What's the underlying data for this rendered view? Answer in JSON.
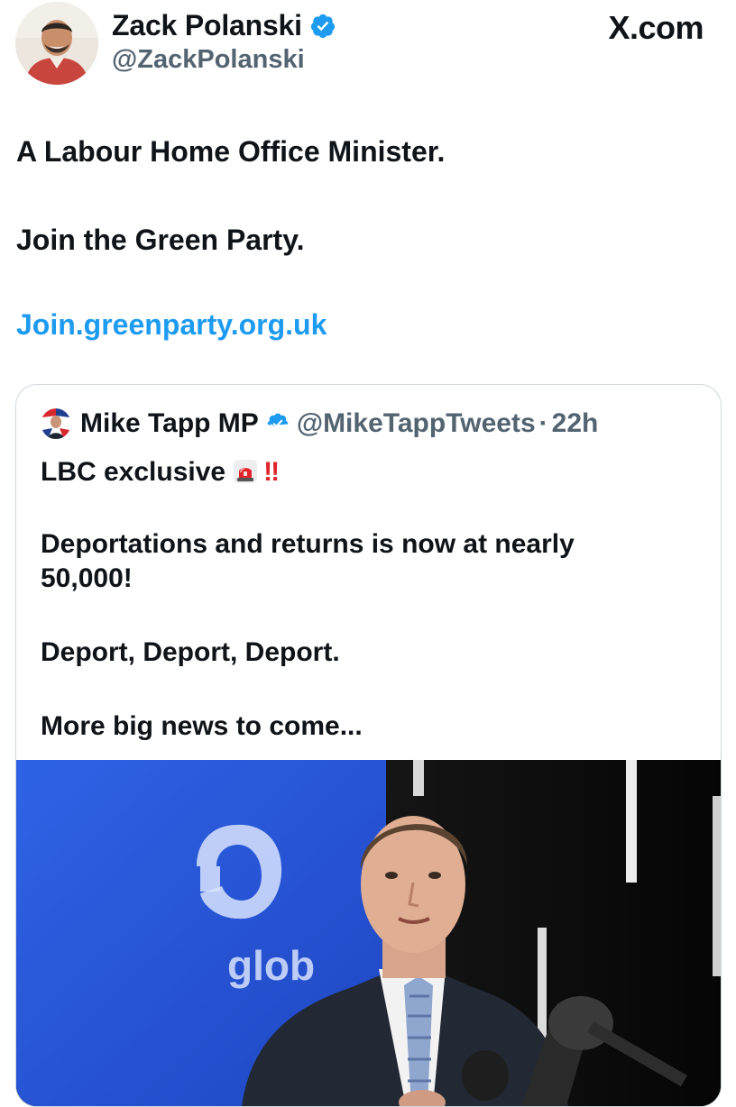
{
  "header": {
    "author_name": "Zack Polanski",
    "author_handle": "@ZackPolanski",
    "site_label": "X.com"
  },
  "tweet": {
    "lines": [
      "A Labour Home Office Minister.",
      "Join the Green Party.",
      "Join.greenparty.org.uk"
    ]
  },
  "quoted_tweet": {
    "author_name": "Mike Tapp MP",
    "author_handle": "@MikeTappTweets",
    "separator": "·",
    "time": "22h",
    "line1": "LBC exclusive",
    "line1_emoji": "siren-icon",
    "line1_marks": "!!",
    "line2a": "Deportations and returns is now at nearly",
    "line2b": "50,000!",
    "line3": "Deport, Deport, Deport.",
    "line4": "More big news to come...",
    "media_watermark": "glob"
  },
  "colors": {
    "link": "#1d9bf0",
    "verified": "#1d9bf0",
    "secondary_text": "#536471",
    "border": "#cfd9de",
    "alert_red": "#e0242a",
    "media_blue": "#2a56d8"
  }
}
